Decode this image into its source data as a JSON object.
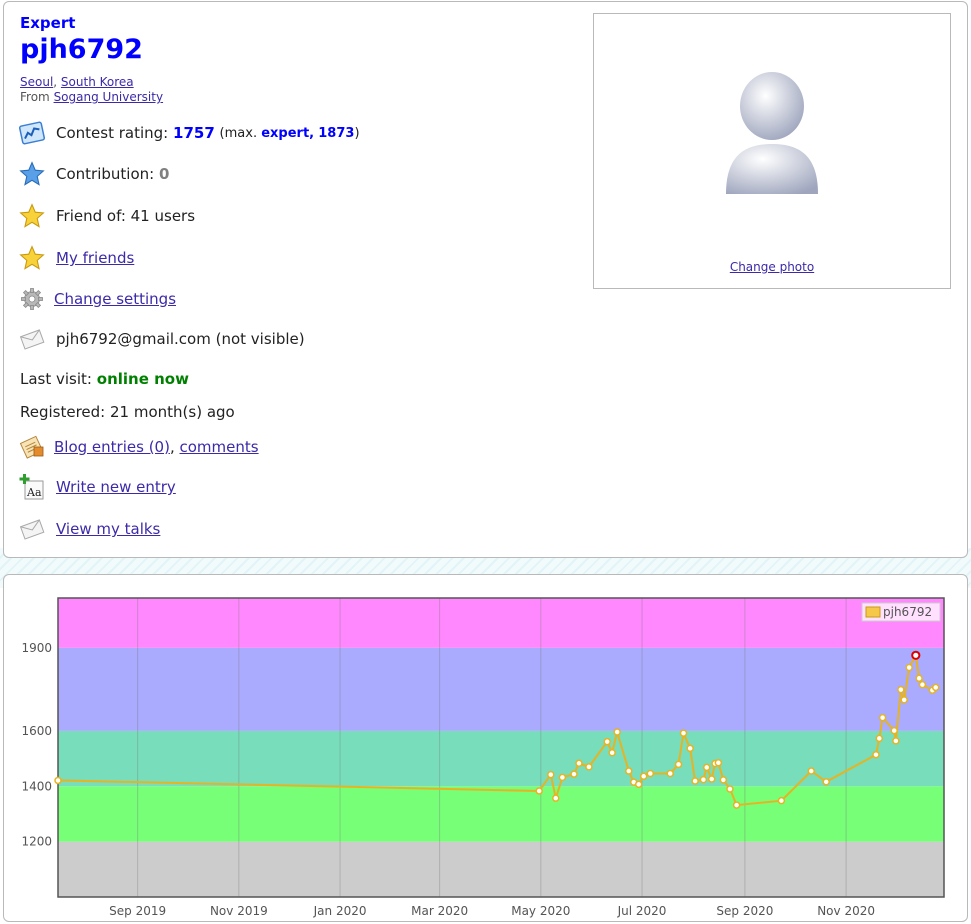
{
  "profile": {
    "rank": "Expert",
    "handle": "pjh6792",
    "city": "Seoul",
    "country": "South Korea",
    "from_label": "From",
    "organization": "Sogang University",
    "rating_label": "Contest rating:",
    "rating_value": "1757",
    "rating_max_prefix": "(max.",
    "rating_max_rank": "expert,",
    "rating_max_value": "1873",
    "rating_max_suffix": ")",
    "contribution_label": "Contribution:",
    "contribution_value": "0",
    "friend_of": "Friend of: 41 users",
    "my_friends": "My friends",
    "change_settings": "Change settings",
    "email": "pjh6792@gmail.com (not visible)",
    "last_visit_label": "Last visit:",
    "last_visit_value": "online now",
    "registered": "Registered: 21 month(s) ago",
    "blog_entries": "Blog entries (0)",
    "comma": ",",
    "comments": "comments",
    "write_entry": "Write new entry",
    "view_talks": "View my talks",
    "change_photo": "Change photo"
  },
  "icons": {
    "rating": "rating-chart-icon",
    "contribution": "blue-star-icon",
    "friend_of": "gold-star-icon",
    "my_friends": "gold-star-icon",
    "settings": "gear-icon",
    "email": "envelope-icon",
    "blog": "blog-notepad-icon",
    "write": "write-entry-icon",
    "talks": "envelope-icon"
  },
  "colors": {
    "rank_blue": "#0000ff",
    "online_green": "#008000",
    "line": "#e6b422",
    "band_master": "#ff88ff",
    "band_cm": "#aaaaff",
    "band_expert": "#77ddbb",
    "band_specialist": "#77ff77",
    "band_newbie": "#cccccc"
  },
  "chart_data": {
    "type": "line",
    "legend": "pjh6792",
    "legend_position": "top-right",
    "grid": true,
    "xlim": [
      "2019-07-15",
      "2020-12-30"
    ],
    "ylim": [
      1000,
      2080
    ],
    "y_ticks": [
      1200,
      1400,
      1600,
      1900
    ],
    "x_ticks": [
      {
        "date": "2019-09-01",
        "label": "Sep 2019"
      },
      {
        "date": "2019-11-01",
        "label": "Nov 2019"
      },
      {
        "date": "2020-01-01",
        "label": "Jan 2020"
      },
      {
        "date": "2020-03-01",
        "label": "Mar 2020"
      },
      {
        "date": "2020-05-01",
        "label": "May 2020"
      },
      {
        "date": "2020-07-01",
        "label": "Jul 2020"
      },
      {
        "date": "2020-09-01",
        "label": "Sep 2020"
      },
      {
        "date": "2020-11-01",
        "label": "Nov 2020"
      }
    ],
    "bands": [
      {
        "from": 1000,
        "to": 1200,
        "color": "#cccccc"
      },
      {
        "from": 1200,
        "to": 1400,
        "color": "#77ff77"
      },
      {
        "from": 1400,
        "to": 1600,
        "color": "#77ddbb"
      },
      {
        "from": 1600,
        "to": 1900,
        "color": "#aaaaff"
      },
      {
        "from": 1900,
        "to": 2080,
        "color": "#ff88ff"
      }
    ],
    "max_point": {
      "date": "2020-12-13",
      "value": 1873
    },
    "series": [
      {
        "name": "pjh6792",
        "points": [
          [
            "2019-07-15",
            1421
          ],
          [
            "2020-04-30",
            1383
          ],
          [
            "2020-05-07",
            1442
          ],
          [
            "2020-05-10",
            1357
          ],
          [
            "2020-05-14",
            1432
          ],
          [
            "2020-05-21",
            1444
          ],
          [
            "2020-05-24",
            1483
          ],
          [
            "2020-05-30",
            1470
          ],
          [
            "2020-06-10",
            1561
          ],
          [
            "2020-06-13",
            1521
          ],
          [
            "2020-06-16",
            1596
          ],
          [
            "2020-06-23",
            1455
          ],
          [
            "2020-06-26",
            1415
          ],
          [
            "2020-06-29",
            1407
          ],
          [
            "2020-07-02",
            1436
          ],
          [
            "2020-07-06",
            1446
          ],
          [
            "2020-07-18",
            1446
          ],
          [
            "2020-07-23",
            1479
          ],
          [
            "2020-07-26",
            1592
          ],
          [
            "2020-07-30",
            1537
          ],
          [
            "2020-08-02",
            1419
          ],
          [
            "2020-08-07",
            1424
          ],
          [
            "2020-08-09",
            1468
          ],
          [
            "2020-08-12",
            1426
          ],
          [
            "2020-08-14",
            1482
          ],
          [
            "2020-08-16",
            1485
          ],
          [
            "2020-08-19",
            1423
          ],
          [
            "2020-08-23",
            1390
          ],
          [
            "2020-08-27",
            1332
          ],
          [
            "2020-09-23",
            1348
          ],
          [
            "2020-10-11",
            1455
          ],
          [
            "2020-10-20",
            1416
          ],
          [
            "2020-11-19",
            1514
          ],
          [
            "2020-11-21",
            1573
          ],
          [
            "2020-11-23",
            1648
          ],
          [
            "2020-11-30",
            1601
          ],
          [
            "2020-12-01",
            1564
          ],
          [
            "2020-12-04",
            1749
          ],
          [
            "2020-12-06",
            1712
          ],
          [
            "2020-12-09",
            1829
          ],
          [
            "2020-12-13",
            1873
          ],
          [
            "2020-12-15",
            1790
          ],
          [
            "2020-12-17",
            1767
          ],
          [
            "2020-12-23",
            1747
          ],
          [
            "2020-12-25",
            1757
          ]
        ]
      }
    ]
  }
}
